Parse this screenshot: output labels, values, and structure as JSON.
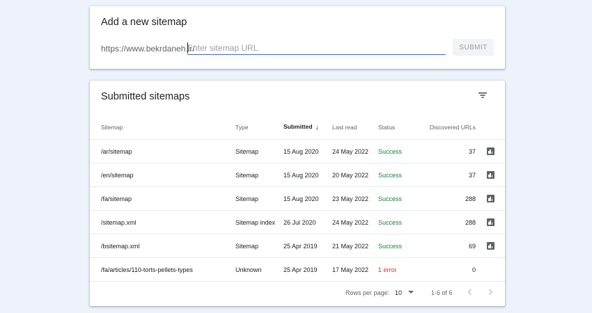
{
  "add_card": {
    "title": "Add a new sitemap",
    "url_prefix": "https://www.bekrdaneh.ir/",
    "input_placeholder": "Enter sitemap URL",
    "submit_label": "SUBMIT"
  },
  "submitted_card": {
    "title": "Submitted sitemaps",
    "filter_icon": "filter-list-icon",
    "columns": {
      "sitemap": "Sitemap",
      "type": "Type",
      "submitted": "Submitted",
      "last_read": "Last read",
      "status": "Status",
      "discovered_urls": "Discovered URLs"
    },
    "sorted_column": "submitted",
    "sort_direction": "descending",
    "rows": [
      {
        "sitemap": "/ar/sitemap",
        "type": "Sitemap",
        "submitted": "15 Aug 2020",
        "last_read": "24 May 2022",
        "status": "Success",
        "discovered_urls": "37",
        "has_chart": true
      },
      {
        "sitemap": "/en/sitemap",
        "type": "Sitemap",
        "submitted": "15 Aug 2020",
        "last_read": "20 May 2022",
        "status": "Success",
        "discovered_urls": "37",
        "has_chart": true
      },
      {
        "sitemap": "/fa/sitemap",
        "type": "Sitemap",
        "submitted": "15 Aug 2020",
        "last_read": "23 May 2022",
        "status": "Success",
        "discovered_urls": "288",
        "has_chart": true
      },
      {
        "sitemap": "/sitemap.xml",
        "type": "Sitemap index",
        "submitted": "26 Jul 2020",
        "last_read": "24 May 2022",
        "status": "Success",
        "discovered_urls": "288",
        "has_chart": true
      },
      {
        "sitemap": "/bsitemap.xml",
        "type": "Sitemap",
        "submitted": "25 Apr 2019",
        "last_read": "21 May 2022",
        "status": "Success",
        "discovered_urls": "69",
        "has_chart": true
      },
      {
        "sitemap": "/fa/articles/110-torts-pellets-types",
        "type": "Unknown",
        "submitted": "25 Apr 2019",
        "last_read": "17 May 2022",
        "status": "1 error",
        "discovered_urls": "0",
        "has_chart": false
      }
    ],
    "footer": {
      "rows_per_page_label": "Rows per page:",
      "rows_per_page_value": "10",
      "range_text": "1-6 of 6"
    }
  },
  "colors": {
    "background": "#eef2fb",
    "accent": "#1a73e8",
    "success": "#188038",
    "error": "#d93025"
  }
}
